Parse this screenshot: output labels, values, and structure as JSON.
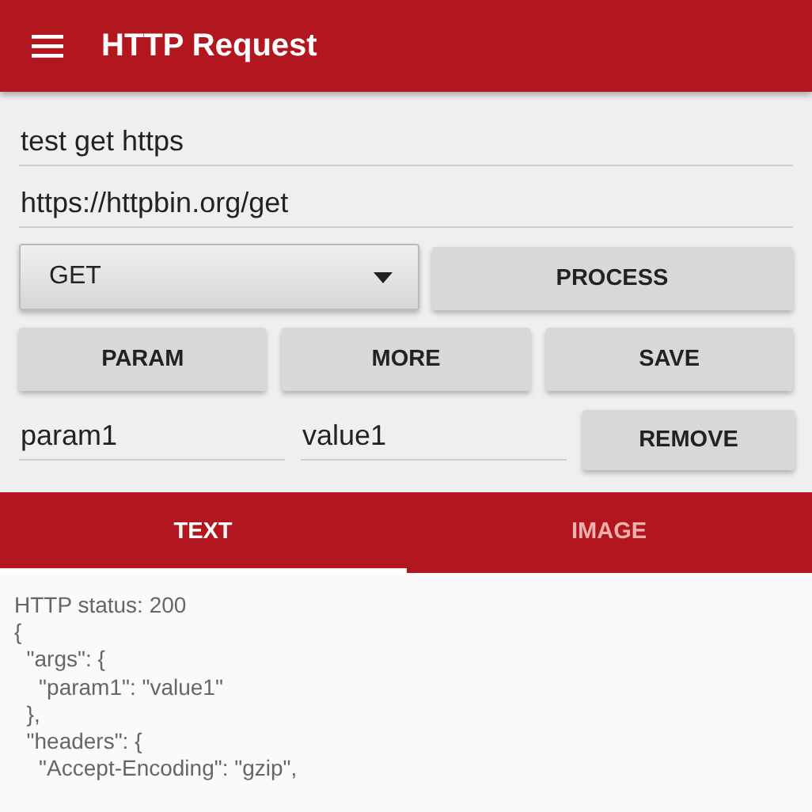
{
  "app_bar": {
    "title": "HTTP Request"
  },
  "fields": [
    {
      "value": "test get https"
    },
    {
      "value": "https://httpbin.org/get"
    }
  ],
  "method": {
    "value": "GET"
  },
  "buttons": [
    {
      "label": "PROCESS"
    },
    {
      "label": "PARAM"
    },
    {
      "label": "MORE"
    },
    {
      "label": "SAVE"
    }
  ],
  "param_row": {
    "name": "param1",
    "value": "value1",
    "button": "REMOVE"
  },
  "tabs": [
    {
      "label": "TEXT",
      "selected": true
    },
    {
      "label": "IMAGE",
      "selected": false
    }
  ],
  "output": [
    "HTTP status: 200",
    "{",
    "  \"args\": {",
    "    \"param1\": \"value1\"",
    "  },",
    "  \"headers\": {",
    "    \"Accept-Encoding\": \"gzip\","
  ]
}
